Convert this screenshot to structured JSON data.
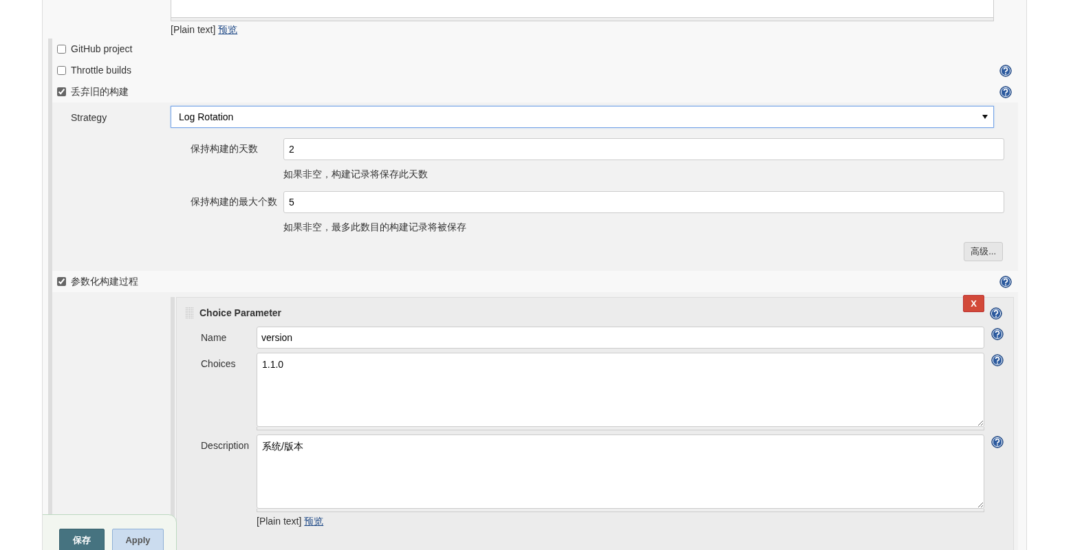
{
  "description_editor": {
    "markup_note": "[Plain text]",
    "preview_link": "预览"
  },
  "options": [
    {
      "label": "GitHub project",
      "checked": false,
      "help": false
    },
    {
      "label": "Throttle builds",
      "checked": false,
      "help": true
    },
    {
      "label": "丢弃旧的构建",
      "checked": true,
      "help": true
    }
  ],
  "discard_strategy": {
    "label": "Strategy",
    "value": "Log Rotation",
    "fields": [
      {
        "label": "保持构建的天数",
        "value": "2",
        "hint": "如果非空，构建记录将保存此天数"
      },
      {
        "label": "保持构建的最大个数",
        "value": "5",
        "hint": "如果非空，最多此数目的构建记录将被保存"
      }
    ],
    "advanced_button": "高级..."
  },
  "parameterized": {
    "label": "参数化构建过程",
    "checked": true,
    "help": true,
    "parameter": {
      "title": "Choice Parameter",
      "delete_button": "X",
      "fields": [
        {
          "kind": "input",
          "label": "Name",
          "value": "version"
        },
        {
          "kind": "textarea",
          "label": "Choices",
          "value": "1.1.0"
        },
        {
          "kind": "textarea",
          "label": "Description",
          "value": "系统/版本"
        }
      ],
      "markup_note": "[Plain text]",
      "preview_link": "预览"
    }
  },
  "buttons": [
    {
      "label": "保存",
      "kind": "primary"
    },
    {
      "label": "Apply",
      "kind": "secondary"
    }
  ]
}
